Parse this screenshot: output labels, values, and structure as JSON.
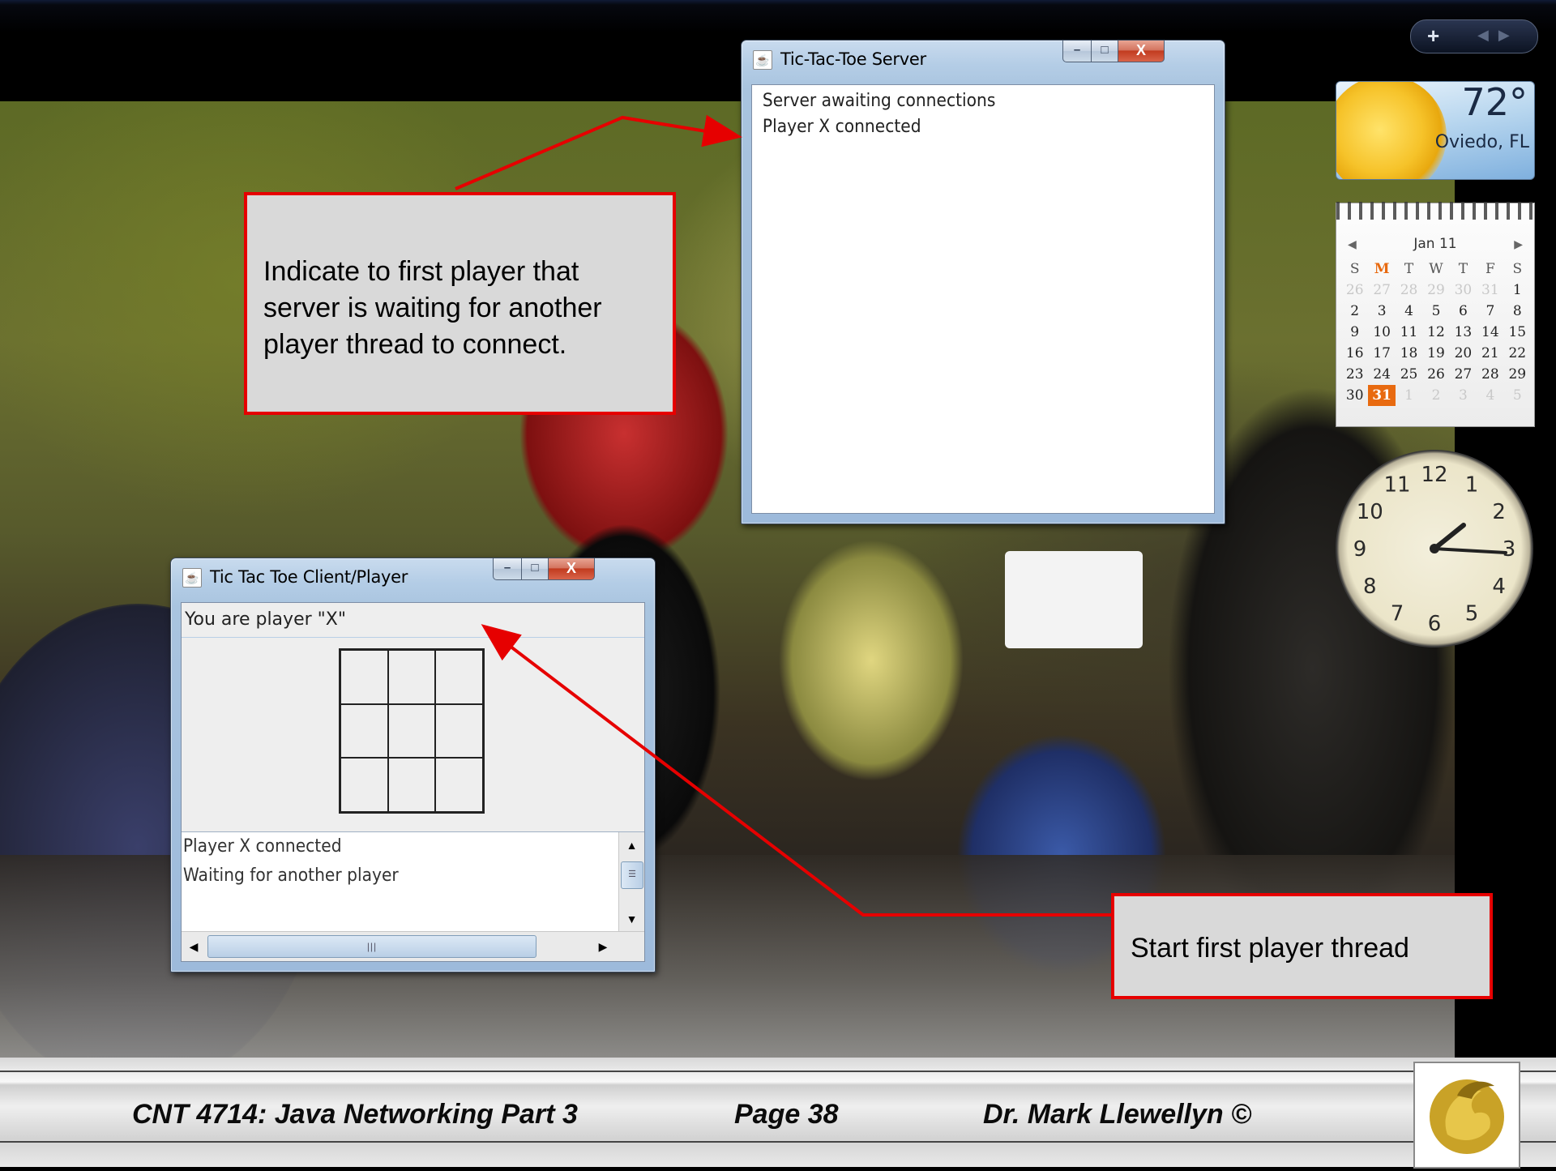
{
  "server_window": {
    "title": "Tic-Tac-Toe Server",
    "log": [
      "Server awaiting connections",
      "Player X connected"
    ],
    "buttons": {
      "minimize": "–",
      "maximize": "□",
      "close": "X"
    }
  },
  "client_window": {
    "title": "Tic Tac Toe Client/Player",
    "id_field": "You are player \"X\"",
    "messages": [
      "Player X connected",
      "Waiting for another player"
    ],
    "buttons": {
      "minimize": "–",
      "maximize": "□",
      "close": "X"
    }
  },
  "callouts": {
    "server_note": "Indicate to first player that server is waiting for another player thread to connect.",
    "client_note": "Start first player thread"
  },
  "gadgets": {
    "weather": {
      "temperature": "72°",
      "location": "Oviedo, FL"
    },
    "calendar": {
      "month": "Jan 11",
      "weekdays": [
        "S",
        "M",
        "T",
        "W",
        "T",
        "F",
        "S"
      ],
      "today_weekday": "M",
      "days": [
        [
          "26",
          "27",
          "28",
          "29",
          "30",
          "31",
          "1"
        ],
        [
          "2",
          "3",
          "4",
          "5",
          "6",
          "7",
          "8"
        ],
        [
          "9",
          "10",
          "11",
          "12",
          "13",
          "14",
          "15"
        ],
        [
          "16",
          "17",
          "18",
          "19",
          "20",
          "21",
          "22"
        ],
        [
          "23",
          "24",
          "25",
          "26",
          "27",
          "28",
          "29"
        ],
        [
          "30",
          "31",
          "1",
          "2",
          "3",
          "4",
          "5"
        ]
      ],
      "selected_day": "31"
    },
    "clock": {
      "numerals": [
        "12",
        "1",
        "2",
        "3",
        "4",
        "5",
        "6",
        "7",
        "8",
        "9",
        "10",
        "11"
      ]
    }
  },
  "footer": {
    "course": "CNT 4714: Java Networking Part 3",
    "page": "Page 38",
    "author": "Dr.  Mark Llewellyn ©"
  },
  "colors": {
    "callout_border": "#e60000",
    "callout_fill": "#d9d9d9",
    "calendar_accent": "#e86a10"
  }
}
